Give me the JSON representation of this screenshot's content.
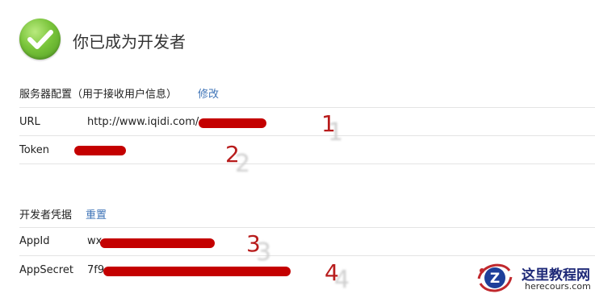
{
  "header": {
    "title": "你已成为开发者"
  },
  "server_config": {
    "section_label": "服务器配置（用于接收用户信息）",
    "edit_label": "修改",
    "rows": [
      {
        "label": "URL",
        "value": "http://www.iqidi.com/"
      },
      {
        "label": "Token",
        "value": ""
      }
    ]
  },
  "credentials": {
    "section_label": "开发者凭据",
    "reset_label": "重置",
    "rows": [
      {
        "label": "AppId",
        "value": "wx"
      },
      {
        "label": "AppSecret",
        "value": "7f9"
      }
    ]
  },
  "annotations": [
    "1",
    "2",
    "3",
    "4"
  ],
  "watermark": {
    "title": "这里教程网",
    "url": "herecours.com",
    "letter": "Z"
  },
  "colors": {
    "accent_link": "#3f74b7",
    "redaction": "#c40000",
    "annotation": "#b81c1c",
    "check_green": "#79c43a"
  },
  "icons": {
    "success": "check-circle-icon"
  }
}
